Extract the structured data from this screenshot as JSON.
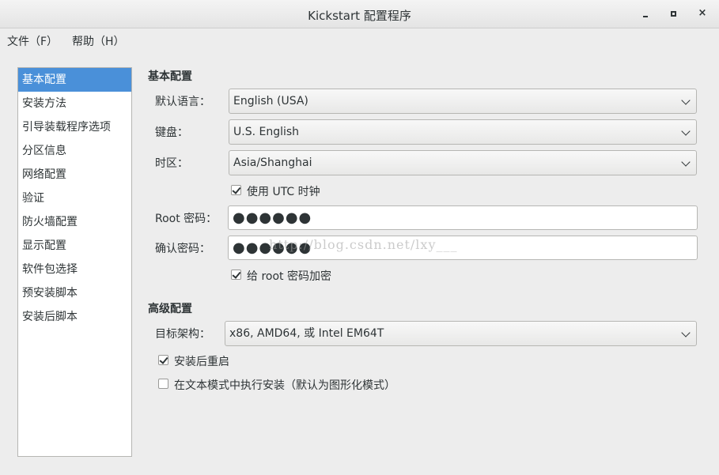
{
  "window": {
    "title": "Kickstart 配置程序",
    "close_glyph": "×"
  },
  "menu": {
    "file": "文件（F）",
    "help": "帮助（H）"
  },
  "sidebar": {
    "items": [
      {
        "label": "基本配置",
        "selected": true
      },
      {
        "label": "安装方法"
      },
      {
        "label": "引导装载程序选项"
      },
      {
        "label": "分区信息"
      },
      {
        "label": "网络配置"
      },
      {
        "label": "验证"
      },
      {
        "label": "防火墙配置"
      },
      {
        "label": "显示配置"
      },
      {
        "label": "软件包选择"
      },
      {
        "label": "预安装脚本"
      },
      {
        "label": "安装后脚本"
      }
    ]
  },
  "basic": {
    "section_title": "基本配置",
    "language_label": "默认语言：",
    "language_value": "English (USA)",
    "keyboard_label": "键盘：",
    "keyboard_value": "U.S. English",
    "timezone_label": "时区：",
    "timezone_value": "Asia/Shanghai",
    "utc_label": "使用  UTC 时钟",
    "utc_checked": true,
    "root_pw_label": "Root 密码：",
    "root_pw_value": "●●●●●●",
    "confirm_pw_label": "确认密码：",
    "confirm_pw_value": "●●●●●●",
    "encrypt_label": "给  root 密码加密",
    "encrypt_checked": true
  },
  "advanced": {
    "section_title": "高级配置",
    "arch_label": "目标架构：",
    "arch_value": "x86, AMD64, 或  Intel EM64T",
    "reboot_label": "安装后重启",
    "reboot_checked": true,
    "textmode_label": "在文本模式中执行安装（默认为图形化模式）",
    "textmode_checked": false
  },
  "watermark": "http://blog.csdn.net/lxy___"
}
